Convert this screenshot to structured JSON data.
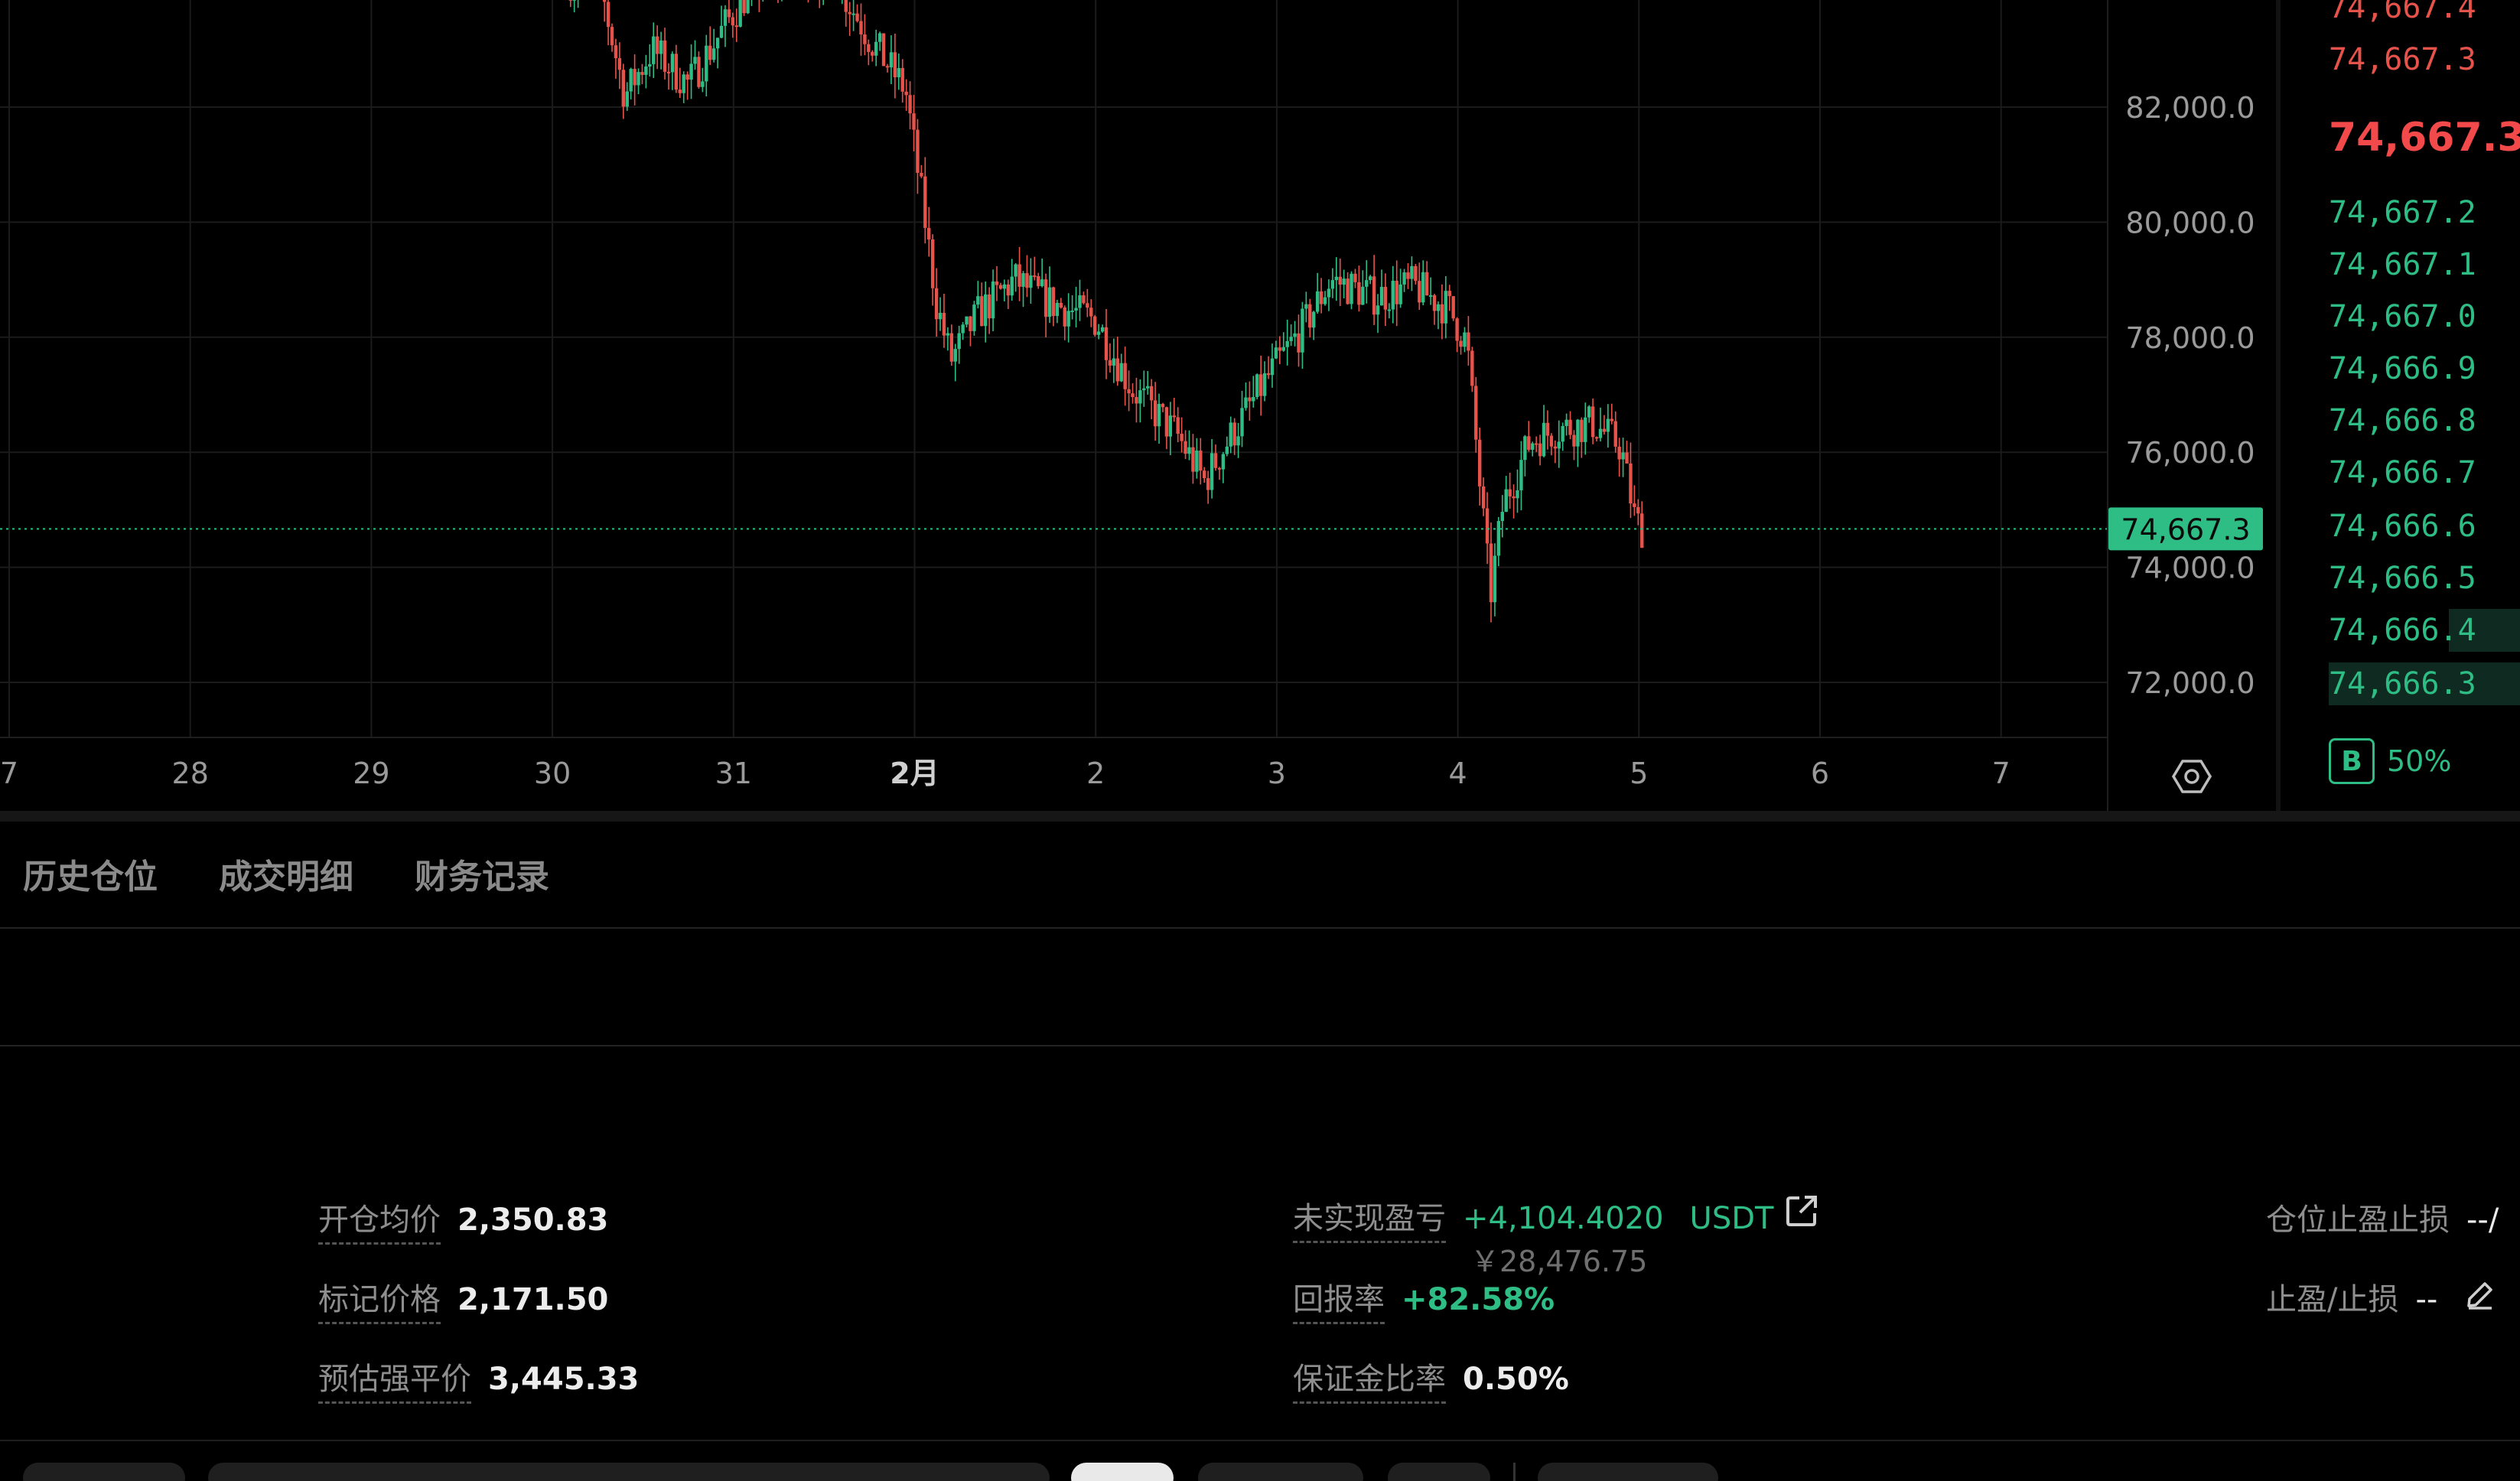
{
  "chart": {
    "price_axis_labels": [
      "82,000.0",
      "80,000.0",
      "78,000.0",
      "76,000.0",
      "74,000.0",
      "72,000.0"
    ],
    "date_axis_labels": [
      "7",
      "28",
      "29",
      "30",
      "31",
      "2月",
      "2",
      "3",
      "4",
      "5",
      "6",
      "7"
    ],
    "current_price_tag": "74,667.3"
  },
  "chart_data": {
    "type": "candlestick",
    "y_ticks": [
      82000,
      80000,
      78000,
      76000,
      74000,
      72000
    ],
    "x_ticks": [
      "7",
      "28",
      "29",
      "30",
      "31",
      "2月",
      "2",
      "3",
      "4",
      "5",
      "6",
      "7"
    ],
    "last_price": 74667.3,
    "grid": true,
    "colors": {
      "up": "#2ebd85",
      "down": "#e5534b",
      "grid": "#1b1b1b"
    },
    "price_path": [
      [
        30.1,
        84200
      ],
      [
        30.25,
        84300
      ],
      [
        30.4,
        82200
      ],
      [
        30.55,
        83000
      ],
      [
        30.75,
        82400
      ],
      [
        30.95,
        83400
      ],
      [
        31.1,
        84100
      ],
      [
        31.3,
        84400
      ],
      [
        31.55,
        84300
      ],
      [
        31.75,
        83200
      ],
      [
        31.95,
        82300
      ],
      [
        32.05,
        80200
      ],
      [
        32.12,
        78600
      ],
      [
        32.2,
        77600
      ],
      [
        32.35,
        78400
      ],
      [
        32.55,
        79000
      ],
      [
        32.75,
        78600
      ],
      [
        33.0,
        78300
      ],
      [
        33.2,
        77100
      ],
      [
        33.45,
        76300
      ],
      [
        33.6,
        75500
      ],
      [
        33.75,
        76300
      ],
      [
        33.95,
        77300
      ],
      [
        34.15,
        78200
      ],
      [
        34.3,
        79000
      ],
      [
        34.55,
        78700
      ],
      [
        34.75,
        78900
      ],
      [
        34.95,
        78500
      ],
      [
        35.05,
        77900
      ],
      [
        35.12,
        75500
      ],
      [
        35.18,
        73500
      ],
      [
        35.25,
        75100
      ],
      [
        35.4,
        76200
      ],
      [
        35.55,
        76400
      ],
      [
        35.75,
        76500
      ],
      [
        35.9,
        76100
      ],
      [
        35.98,
        74800
      ],
      [
        36.02,
        74667.3
      ]
    ]
  },
  "orderbook": {
    "asks": [
      "74,667.4",
      "74,667.3"
    ],
    "last_price": "74,667.3",
    "bids": [
      "74,667.2",
      "74,667.1",
      "74,667.0",
      "74,666.9",
      "74,666.8",
      "74,666.7",
      "74,666.6",
      "74,666.5",
      "74,666.4",
      "74,666.3"
    ],
    "buy_badge": "B",
    "buy_ratio": "50%",
    "colors": {
      "ask": "#e5534b",
      "bid": "#2ebd85",
      "depth": "#0f2a20"
    }
  },
  "tabs": [
    "历史仓位",
    "成交明细",
    "财务记录"
  ],
  "position": {
    "avg_open_label": "开仓均价",
    "avg_open_value": "2,350.83",
    "mark_price_label": "标记价格",
    "mark_price_value": "2,171.50",
    "liq_price_label": "预估强平价",
    "liq_price_value": "3,445.33",
    "upnl_label": "未实现盈亏",
    "upnl_value": "+4,104.4020",
    "upnl_unit": "USDT",
    "upnl_cny": "￥28,476.75",
    "roe_label": "回报率",
    "roe_value": "+82.58%",
    "margin_ratio_label": "保证金比率",
    "margin_ratio_value": "0.50%",
    "tpsl_position_label": "仓位止盈止损",
    "tpsl_position_value": "--/",
    "tpsl_label": "止盈/止损",
    "tpsl_value": "--"
  },
  "icons": {
    "settings": "gear-icon",
    "external_link": "external-link-icon",
    "edit": "edit-pencil-icon"
  }
}
